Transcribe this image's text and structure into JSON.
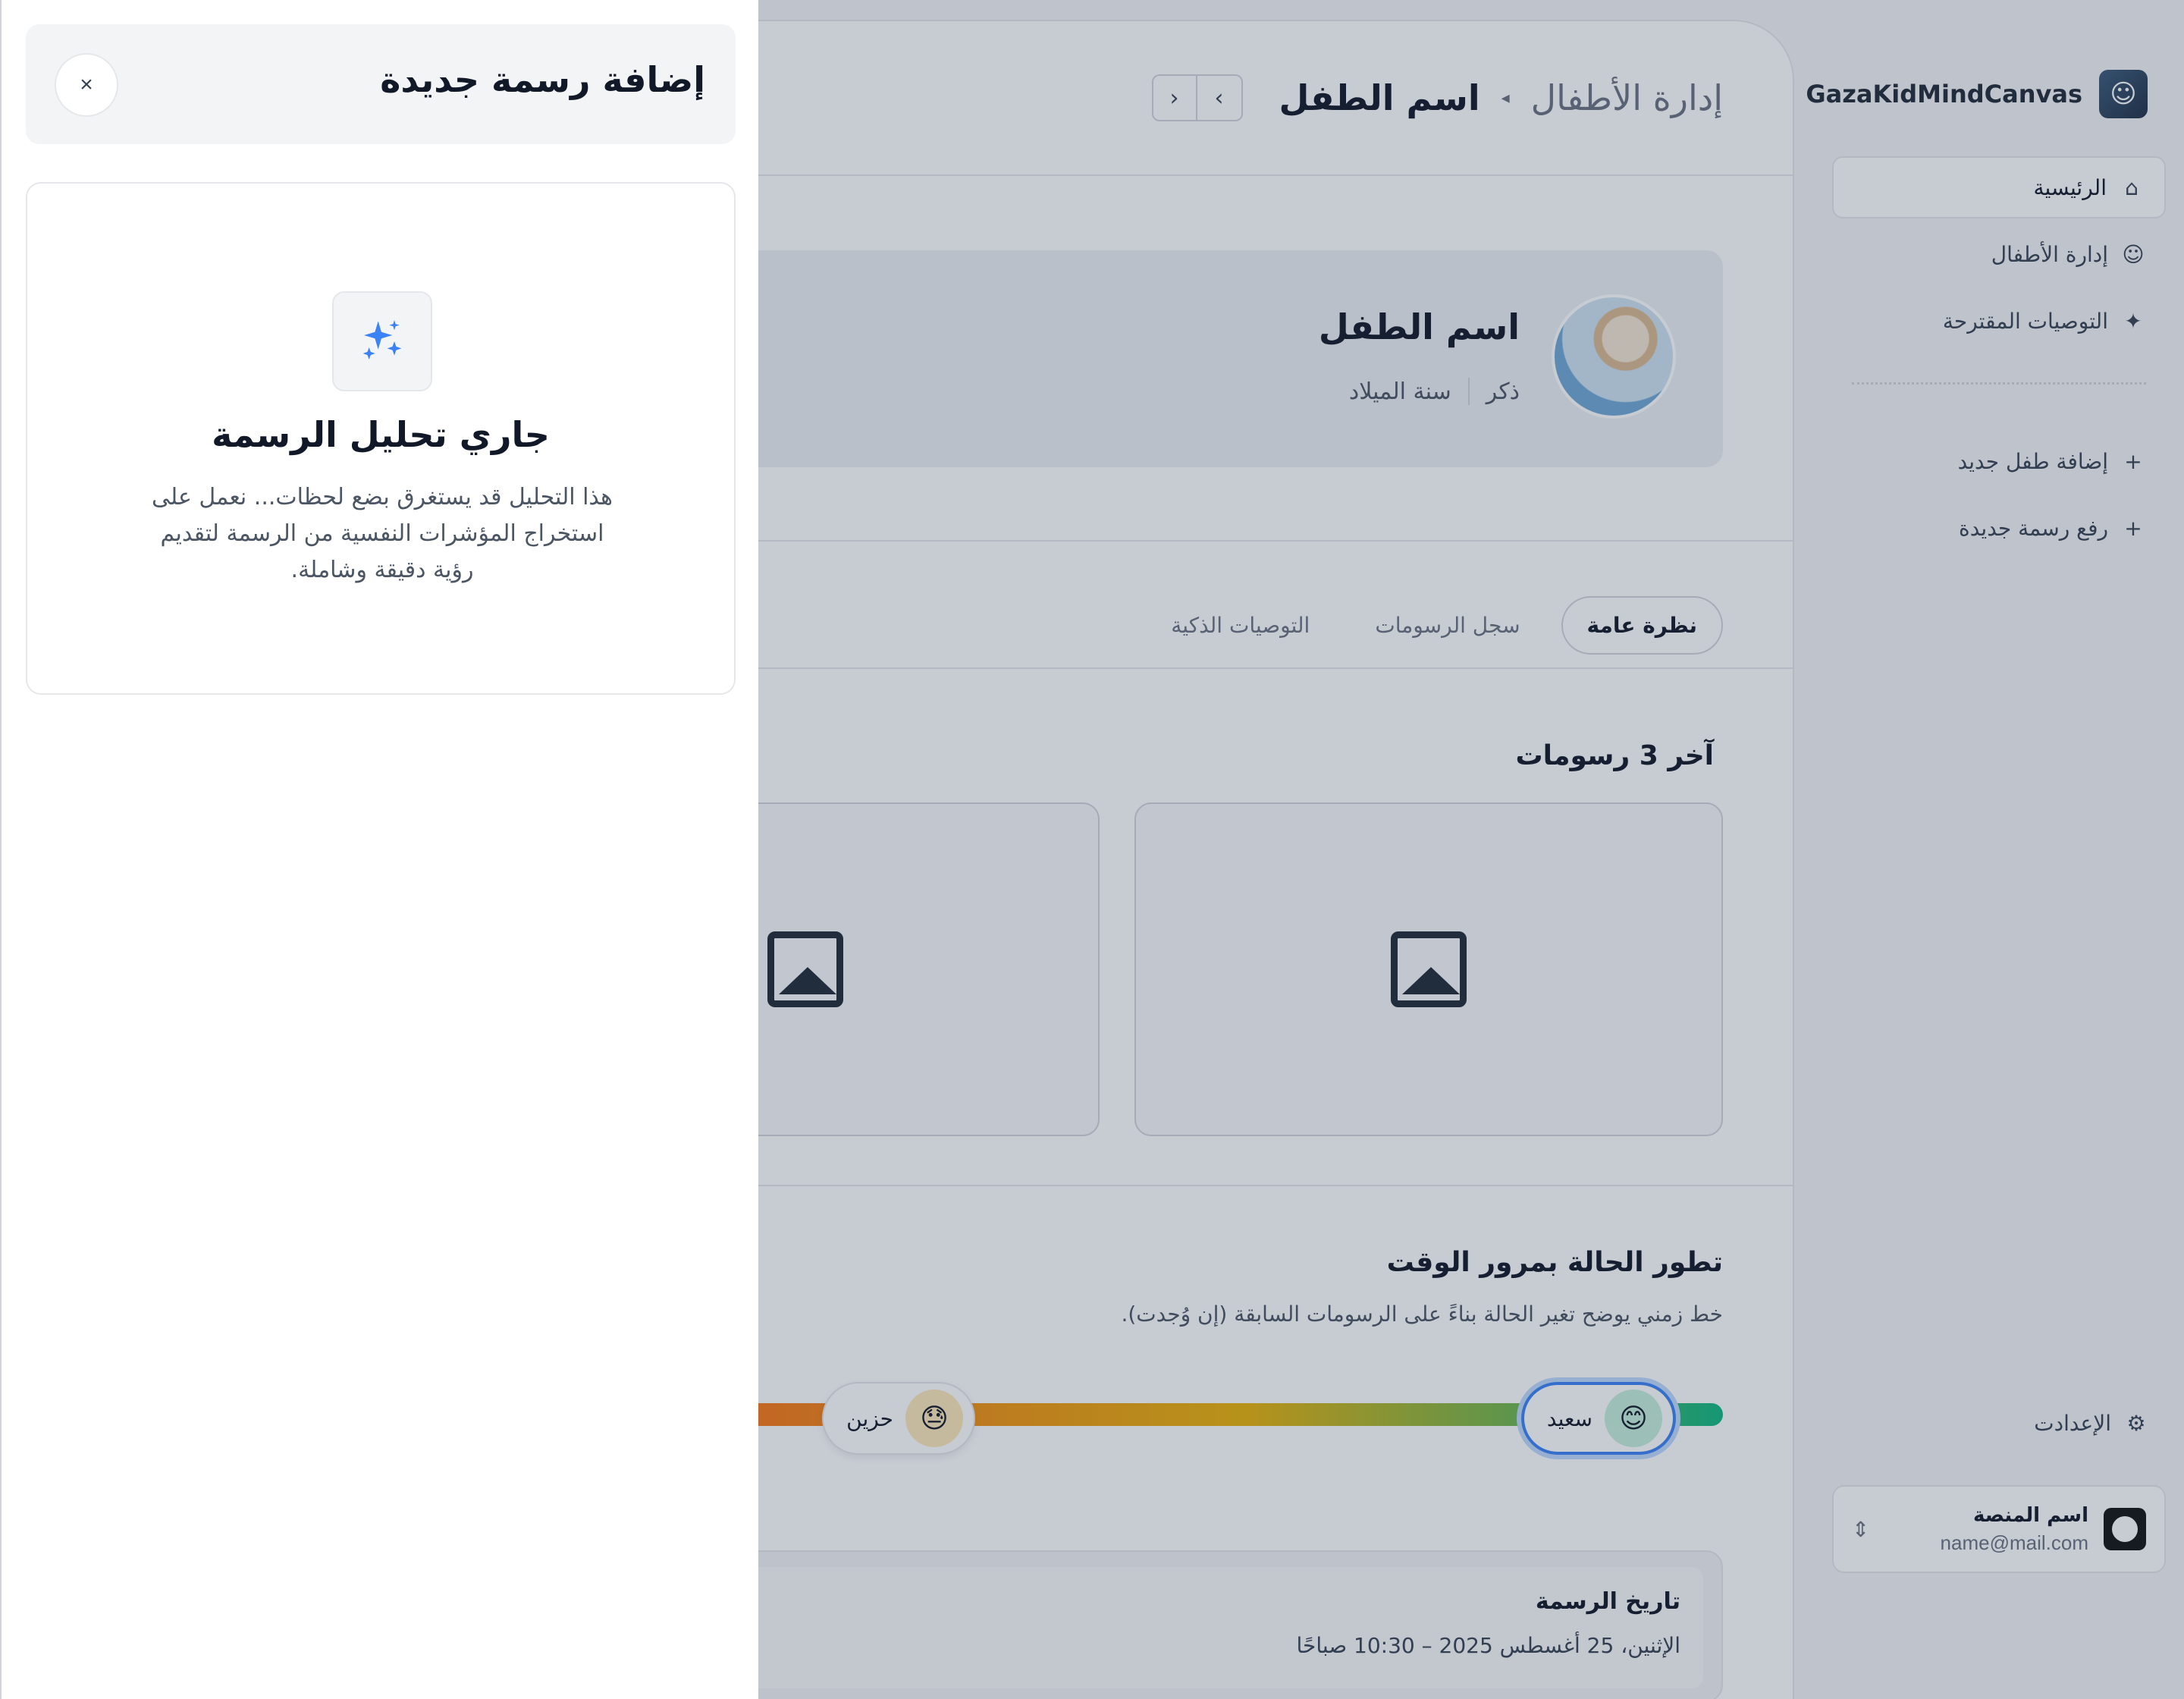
{
  "sidebar": {
    "brand": "GazaKidMindCanvas",
    "items": [
      {
        "label": "الرئيسية",
        "icon": "home-icon"
      },
      {
        "label": "إدارة الأطفال",
        "icon": "child-face-icon"
      },
      {
        "label": "التوصيات المقترحة",
        "icon": "sparkles-icon"
      }
    ],
    "actions": [
      {
        "label": "إضافة طفل جديد",
        "icon": "plus-icon"
      },
      {
        "label": "رفع رسمة جديدة",
        "icon": "plus-icon"
      }
    ],
    "settings_label": "الإعدادت",
    "user": {
      "name": "اسم المنصة",
      "email": "name@mail.com"
    }
  },
  "header": {
    "breadcrumb_parent": "إدارة الأطفال",
    "breadcrumb_current": "اسم الطفل"
  },
  "child": {
    "name": "اسم الطفل",
    "gender": "ذكر",
    "birth_year_label": "سنة الميلاد"
  },
  "tabs": [
    {
      "label": "نظرة عامة",
      "active": true
    },
    {
      "label": "سجل الرسومات",
      "active": false
    },
    {
      "label": "التوصيات الذكية",
      "active": false
    }
  ],
  "recent": {
    "title": "آخر 3 رسومات"
  },
  "timeline": {
    "title": "تطور الحالة بمرور الوقت",
    "subtitle": "خط زمني يوضح تغير الحالة بناءً على الرسومات السابقة (إن وُجدت).",
    "moods": [
      {
        "label": "سعيد",
        "emoji": "😊"
      },
      {
        "label": "حزين",
        "emoji": "😓"
      }
    ]
  },
  "drawing_detail": {
    "date_label": "تاريخ الرسمة",
    "date_value": "الإثنين، 25 أغسطس 2025 – 10:30 صباحًا"
  },
  "panel": {
    "title": "إضافة رسمة جديدة",
    "close_symbol": "×",
    "analysis_title": "جاري تحليل الرسمة",
    "analysis_desc": "هذا التحليل قد يستغرق بضع لحظات... نعمل على استخراج المؤشرات النفسية من الرسمة لتقديم رؤية دقيقة وشاملة."
  },
  "colors": {
    "accent": "#3b82f6",
    "sparkle": "#3b82f6",
    "overlay": "#28355042"
  }
}
